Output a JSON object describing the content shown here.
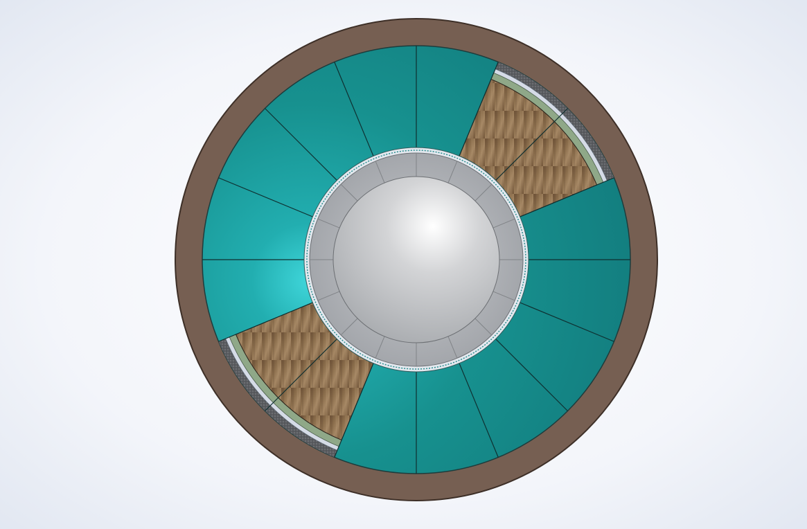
{
  "viewport": {
    "background_colors": [
      "#ffffff",
      "#e4e9f3"
    ]
  },
  "model": {
    "segment_count": 16,
    "colors": {
      "outer_ring": "#765f52",
      "segment_teal": "#17918f",
      "segment_teal_highlight": "#3fd6da",
      "wood": "#7a5e40",
      "wood_light": "#9a7d5a",
      "hub_ring": "#b7babf",
      "hub_center": "#cfd0d2",
      "gasket_green": "#8fa888",
      "foam_dark": "#55575a",
      "liner_light": "#d5dbe6"
    },
    "wood_segments": [
      "upper-right",
      "lower-left"
    ]
  }
}
